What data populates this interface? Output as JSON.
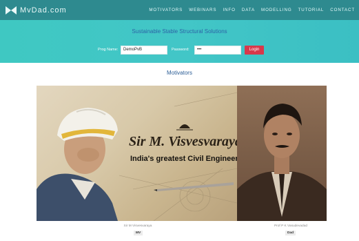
{
  "header": {
    "logo_text": "MvDad.com",
    "menu": [
      "MOTIVATORS",
      "WEBINARS",
      "INFO",
      "DATA",
      "MODELLING",
      "TUTORIAL",
      "CONTACT"
    ]
  },
  "hero": {
    "tagline": "Sustainable Stable Structural Solutions",
    "prog_name_label": "Prog Name:",
    "prog_name_value": "DemoPvB",
    "password_label": "Password:",
    "password_value": "•••",
    "login_label": "Login"
  },
  "main": {
    "section_title": "Motivators",
    "banner": {
      "title": "Sir M. Visvesvaraya",
      "subtitle": "India's greatest Civil Engineer"
    },
    "cards": [
      {
        "caption": "Sir M Visvesvaraya",
        "badge": "MV"
      },
      {
        "caption": "Prof P K Vasudevadad",
        "badge": "Dad"
      }
    ]
  },
  "colors": {
    "nav": "#2e8a8f",
    "hero": "#3fc8c2",
    "accent_blue": "#2d63a6",
    "login_button": "#d8384b"
  }
}
